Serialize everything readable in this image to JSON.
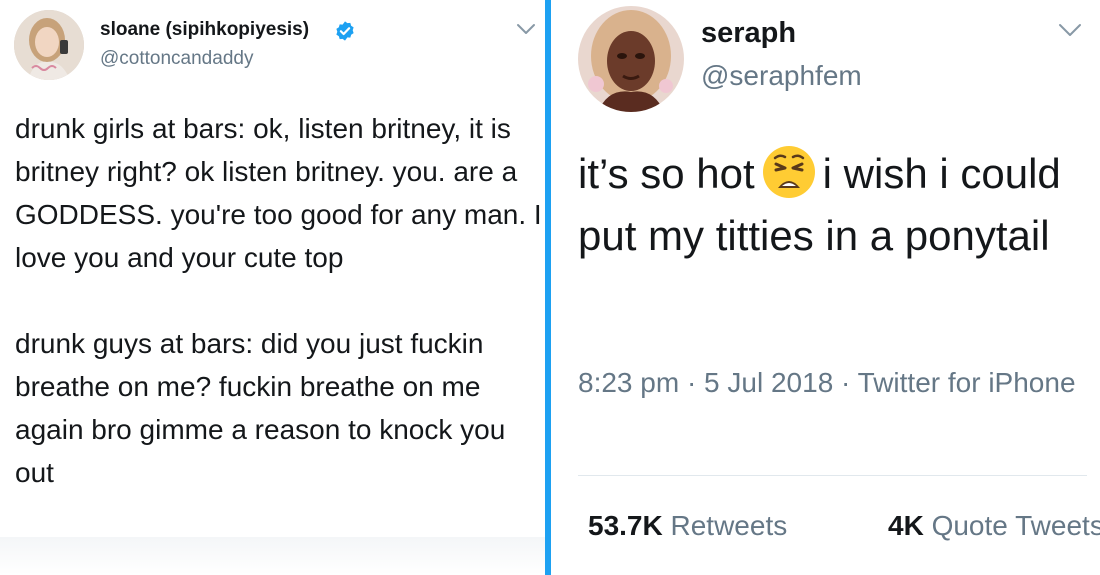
{
  "left_tweet": {
    "display_name": "sloane (sipihkopiyesis)",
    "handle": "@cottoncandaddy",
    "paragraph_1": "drunk girls at bars: ok, listen britney, it is britney right? ok listen britney. you. are a GODDESS. you're too good for any man. I love you and your cute top",
    "paragraph_2": "drunk guys at bars: did you just fuckin breathe on me? fuckin breathe on me again bro gimme a reason to knock you out"
  },
  "right_tweet": {
    "display_name": "seraph",
    "handle": "@seraphfem",
    "text_before_emoji": "it’s so hot",
    "text_after_emoji": "i wish i could put my titties in a ponytail",
    "timestamp": "8:23 pm · 5 Jul 2018 · Twitter for iPhone",
    "retweets_count": "53.7K",
    "retweets_label": "Retweets",
    "quotes_count": "4K",
    "quotes_label": "Quote Tweets"
  },
  "icons": [
    "avatar-sloane",
    "verified-badge-icon",
    "chevron-down-icon",
    "avatar-seraph",
    "weary-face-emoji-icon"
  ],
  "colors": {
    "accent": "#1da1f2",
    "secondary_text": "#657786",
    "primary_text": "#14171a"
  }
}
